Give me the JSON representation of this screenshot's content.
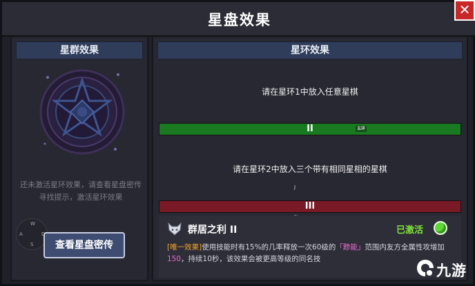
{
  "window": {
    "title": "星盘效果",
    "close_label": "✕"
  },
  "left_panel": {
    "header": "星群效果",
    "hint": "还未激活星环效果，请查看星盘密传寻找提示，激活星环效果",
    "view_button": "查看星盘密传",
    "dpad": {
      "w": "W",
      "a": "A",
      "s": "S",
      "d": "D"
    }
  },
  "right_panel": {
    "header": "星环效果",
    "ring1_requirement": "请在星环1中放入任意星棋",
    "ring2_label": "II",
    "ring2_tag": "五环",
    "ring2_requirement": "请在星环2中放入三个带有相同星相的星棋",
    "marker_j": "J",
    "ring3_label": "III",
    "marker_n": "N",
    "effect": {
      "icon": "wolf-badge-icon",
      "name": "群居之利 II",
      "status": "已激活",
      "desc_tag": "[唯一效果]",
      "desc_part1": "使用技能时有15%的几率释放一次60级的",
      "desc_quote": "「黪能」",
      "desc_part2": "范围内友方全属性攻增加",
      "desc_value": "150",
      "desc_part3": "，持续10秒，该效果会被更高等级的同名技"
    }
  },
  "watermark": {
    "text": "九游",
    "icon": "jiuyou-logo-icon"
  },
  "colors": {
    "ring2": "#1a7a22",
    "ring3": "#7a1a26",
    "active": "#7ee33a",
    "close": "#c7282a"
  }
}
